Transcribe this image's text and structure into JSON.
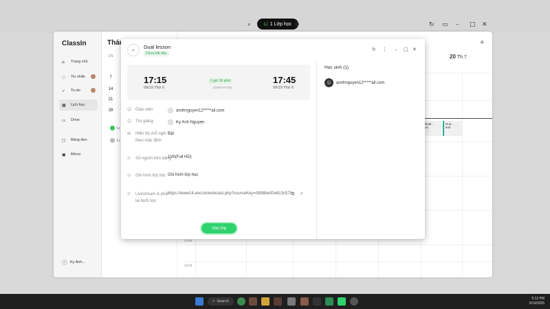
{
  "topbar": {
    "room_label": "1 Lớp học",
    "room_icon": "Li"
  },
  "app": {
    "logo": "ClassIn",
    "nav": [
      {
        "label": "Trang chủ",
        "icon": "home-icon"
      },
      {
        "label": "Tin nhắn",
        "icon": "chat-icon"
      },
      {
        "label": "To-do",
        "icon": "todo-icon"
      },
      {
        "label": "Lịch học",
        "icon": "calendar-icon"
      },
      {
        "label": "Drive",
        "icon": "drive-icon"
      },
      {
        "label": "Bảng đen",
        "icon": "blackboard-icon"
      },
      {
        "label": "Mirror",
        "icon": "mirror-icon"
      }
    ],
    "user_name": "Ky Anh...",
    "user_initial": "K",
    "calendar": {
      "month_title": "Thán",
      "weekday_header": "CN",
      "day_numbers": [
        "7",
        "14",
        "21",
        "28"
      ],
      "legend_labels": [
        "Lị",
        "Lị"
      ]
    },
    "grid": {
      "day_number": "20",
      "day_name": "Th.7",
      "times": [
        "22:00",
        "23:00"
      ],
      "events": [
        {
          "title": "Dual...",
          "sub": "nn"
        },
        {
          "title": "Dua...",
          "sub": "test"
        }
      ]
    }
  },
  "modal": {
    "title": "Dual lesson",
    "status": "Chưa bắt đầu",
    "start_time": "17:15",
    "start_date": "09/19 Thứ 6",
    "end_time": "17:45",
    "end_date": "09/19 Thứ 6",
    "duration": "0 giờ 30 phút",
    "timezone": "(GMT+07:00)",
    "fields": [
      {
        "label": "Giáo viên",
        "value": "annhnguyen12*****ail.com"
      },
      {
        "label": "Trợ giảng",
        "value": "Ky Anh Nguyen"
      },
      {
        "label": "Hiển thị chỗ ngồi theo mặc định",
        "value": "Bật"
      },
      {
        "label": "Số người trên bảng",
        "value": "1V6(Full HD)"
      },
      {
        "label": "Ghi hình lớp học",
        "value": "Ghi hình lớp học"
      },
      {
        "label": "Livestream & phát lại buổi học",
        "value": "https://www14.eeo.im/webcast.php?courseKey=0898be00e813c578"
      }
    ],
    "enter_button": "Vào lớp",
    "students_title": "Học sinh (1)",
    "student_email": "annhnguyen12*****ail.com"
  },
  "taskbar": {
    "search_label": "Search",
    "time": "5:12 PM",
    "date": "9/19/2025"
  },
  "colors": {
    "accent_green": "#2ed36d",
    "status_green": "#3a9a55"
  }
}
